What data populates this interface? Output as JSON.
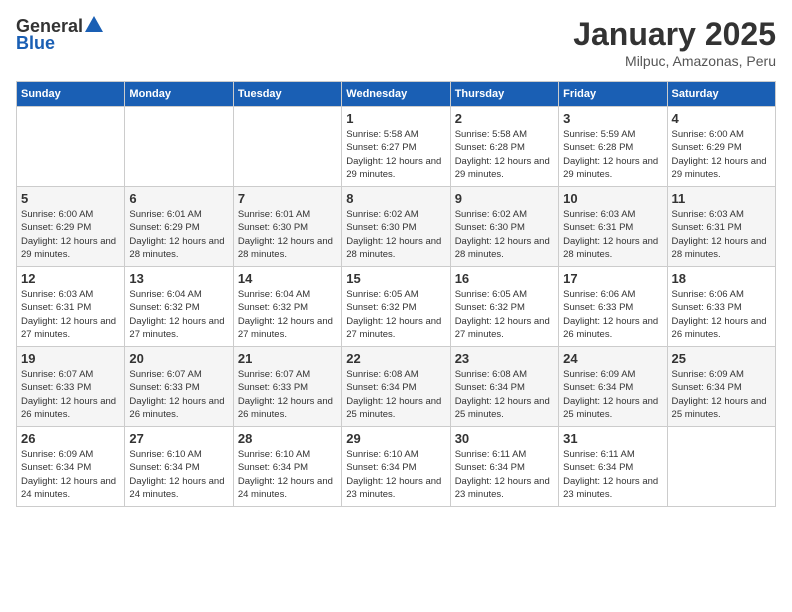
{
  "header": {
    "logo_general": "General",
    "logo_blue": "Blue",
    "title": "January 2025",
    "subtitle": "Milpuc, Amazonas, Peru"
  },
  "calendar": {
    "days_of_week": [
      "Sunday",
      "Monday",
      "Tuesday",
      "Wednesday",
      "Thursday",
      "Friday",
      "Saturday"
    ],
    "weeks": [
      [
        {
          "day": "",
          "sunrise": "",
          "sunset": "",
          "daylight": ""
        },
        {
          "day": "",
          "sunrise": "",
          "sunset": "",
          "daylight": ""
        },
        {
          "day": "",
          "sunrise": "",
          "sunset": "",
          "daylight": ""
        },
        {
          "day": "1",
          "sunrise": "Sunrise: 5:58 AM",
          "sunset": "Sunset: 6:27 PM",
          "daylight": "Daylight: 12 hours and 29 minutes."
        },
        {
          "day": "2",
          "sunrise": "Sunrise: 5:58 AM",
          "sunset": "Sunset: 6:28 PM",
          "daylight": "Daylight: 12 hours and 29 minutes."
        },
        {
          "day": "3",
          "sunrise": "Sunrise: 5:59 AM",
          "sunset": "Sunset: 6:28 PM",
          "daylight": "Daylight: 12 hours and 29 minutes."
        },
        {
          "day": "4",
          "sunrise": "Sunrise: 6:00 AM",
          "sunset": "Sunset: 6:29 PM",
          "daylight": "Daylight: 12 hours and 29 minutes."
        }
      ],
      [
        {
          "day": "5",
          "sunrise": "Sunrise: 6:00 AM",
          "sunset": "Sunset: 6:29 PM",
          "daylight": "Daylight: 12 hours and 29 minutes."
        },
        {
          "day": "6",
          "sunrise": "Sunrise: 6:01 AM",
          "sunset": "Sunset: 6:29 PM",
          "daylight": "Daylight: 12 hours and 28 minutes."
        },
        {
          "day": "7",
          "sunrise": "Sunrise: 6:01 AM",
          "sunset": "Sunset: 6:30 PM",
          "daylight": "Daylight: 12 hours and 28 minutes."
        },
        {
          "day": "8",
          "sunrise": "Sunrise: 6:02 AM",
          "sunset": "Sunset: 6:30 PM",
          "daylight": "Daylight: 12 hours and 28 minutes."
        },
        {
          "day": "9",
          "sunrise": "Sunrise: 6:02 AM",
          "sunset": "Sunset: 6:30 PM",
          "daylight": "Daylight: 12 hours and 28 minutes."
        },
        {
          "day": "10",
          "sunrise": "Sunrise: 6:03 AM",
          "sunset": "Sunset: 6:31 PM",
          "daylight": "Daylight: 12 hours and 28 minutes."
        },
        {
          "day": "11",
          "sunrise": "Sunrise: 6:03 AM",
          "sunset": "Sunset: 6:31 PM",
          "daylight": "Daylight: 12 hours and 28 minutes."
        }
      ],
      [
        {
          "day": "12",
          "sunrise": "Sunrise: 6:03 AM",
          "sunset": "Sunset: 6:31 PM",
          "daylight": "Daylight: 12 hours and 27 minutes."
        },
        {
          "day": "13",
          "sunrise": "Sunrise: 6:04 AM",
          "sunset": "Sunset: 6:32 PM",
          "daylight": "Daylight: 12 hours and 27 minutes."
        },
        {
          "day": "14",
          "sunrise": "Sunrise: 6:04 AM",
          "sunset": "Sunset: 6:32 PM",
          "daylight": "Daylight: 12 hours and 27 minutes."
        },
        {
          "day": "15",
          "sunrise": "Sunrise: 6:05 AM",
          "sunset": "Sunset: 6:32 PM",
          "daylight": "Daylight: 12 hours and 27 minutes."
        },
        {
          "day": "16",
          "sunrise": "Sunrise: 6:05 AM",
          "sunset": "Sunset: 6:32 PM",
          "daylight": "Daylight: 12 hours and 27 minutes."
        },
        {
          "day": "17",
          "sunrise": "Sunrise: 6:06 AM",
          "sunset": "Sunset: 6:33 PM",
          "daylight": "Daylight: 12 hours and 26 minutes."
        },
        {
          "day": "18",
          "sunrise": "Sunrise: 6:06 AM",
          "sunset": "Sunset: 6:33 PM",
          "daylight": "Daylight: 12 hours and 26 minutes."
        }
      ],
      [
        {
          "day": "19",
          "sunrise": "Sunrise: 6:07 AM",
          "sunset": "Sunset: 6:33 PM",
          "daylight": "Daylight: 12 hours and 26 minutes."
        },
        {
          "day": "20",
          "sunrise": "Sunrise: 6:07 AM",
          "sunset": "Sunset: 6:33 PM",
          "daylight": "Daylight: 12 hours and 26 minutes."
        },
        {
          "day": "21",
          "sunrise": "Sunrise: 6:07 AM",
          "sunset": "Sunset: 6:33 PM",
          "daylight": "Daylight: 12 hours and 26 minutes."
        },
        {
          "day": "22",
          "sunrise": "Sunrise: 6:08 AM",
          "sunset": "Sunset: 6:34 PM",
          "daylight": "Daylight: 12 hours and 25 minutes."
        },
        {
          "day": "23",
          "sunrise": "Sunrise: 6:08 AM",
          "sunset": "Sunset: 6:34 PM",
          "daylight": "Daylight: 12 hours and 25 minutes."
        },
        {
          "day": "24",
          "sunrise": "Sunrise: 6:09 AM",
          "sunset": "Sunset: 6:34 PM",
          "daylight": "Daylight: 12 hours and 25 minutes."
        },
        {
          "day": "25",
          "sunrise": "Sunrise: 6:09 AM",
          "sunset": "Sunset: 6:34 PM",
          "daylight": "Daylight: 12 hours and 25 minutes."
        }
      ],
      [
        {
          "day": "26",
          "sunrise": "Sunrise: 6:09 AM",
          "sunset": "Sunset: 6:34 PM",
          "daylight": "Daylight: 12 hours and 24 minutes."
        },
        {
          "day": "27",
          "sunrise": "Sunrise: 6:10 AM",
          "sunset": "Sunset: 6:34 PM",
          "daylight": "Daylight: 12 hours and 24 minutes."
        },
        {
          "day": "28",
          "sunrise": "Sunrise: 6:10 AM",
          "sunset": "Sunset: 6:34 PM",
          "daylight": "Daylight: 12 hours and 24 minutes."
        },
        {
          "day": "29",
          "sunrise": "Sunrise: 6:10 AM",
          "sunset": "Sunset: 6:34 PM",
          "daylight": "Daylight: 12 hours and 23 minutes."
        },
        {
          "day": "30",
          "sunrise": "Sunrise: 6:11 AM",
          "sunset": "Sunset: 6:34 PM",
          "daylight": "Daylight: 12 hours and 23 minutes."
        },
        {
          "day": "31",
          "sunrise": "Sunrise: 6:11 AM",
          "sunset": "Sunset: 6:34 PM",
          "daylight": "Daylight: 12 hours and 23 minutes."
        },
        {
          "day": "",
          "sunrise": "",
          "sunset": "",
          "daylight": ""
        }
      ]
    ]
  }
}
